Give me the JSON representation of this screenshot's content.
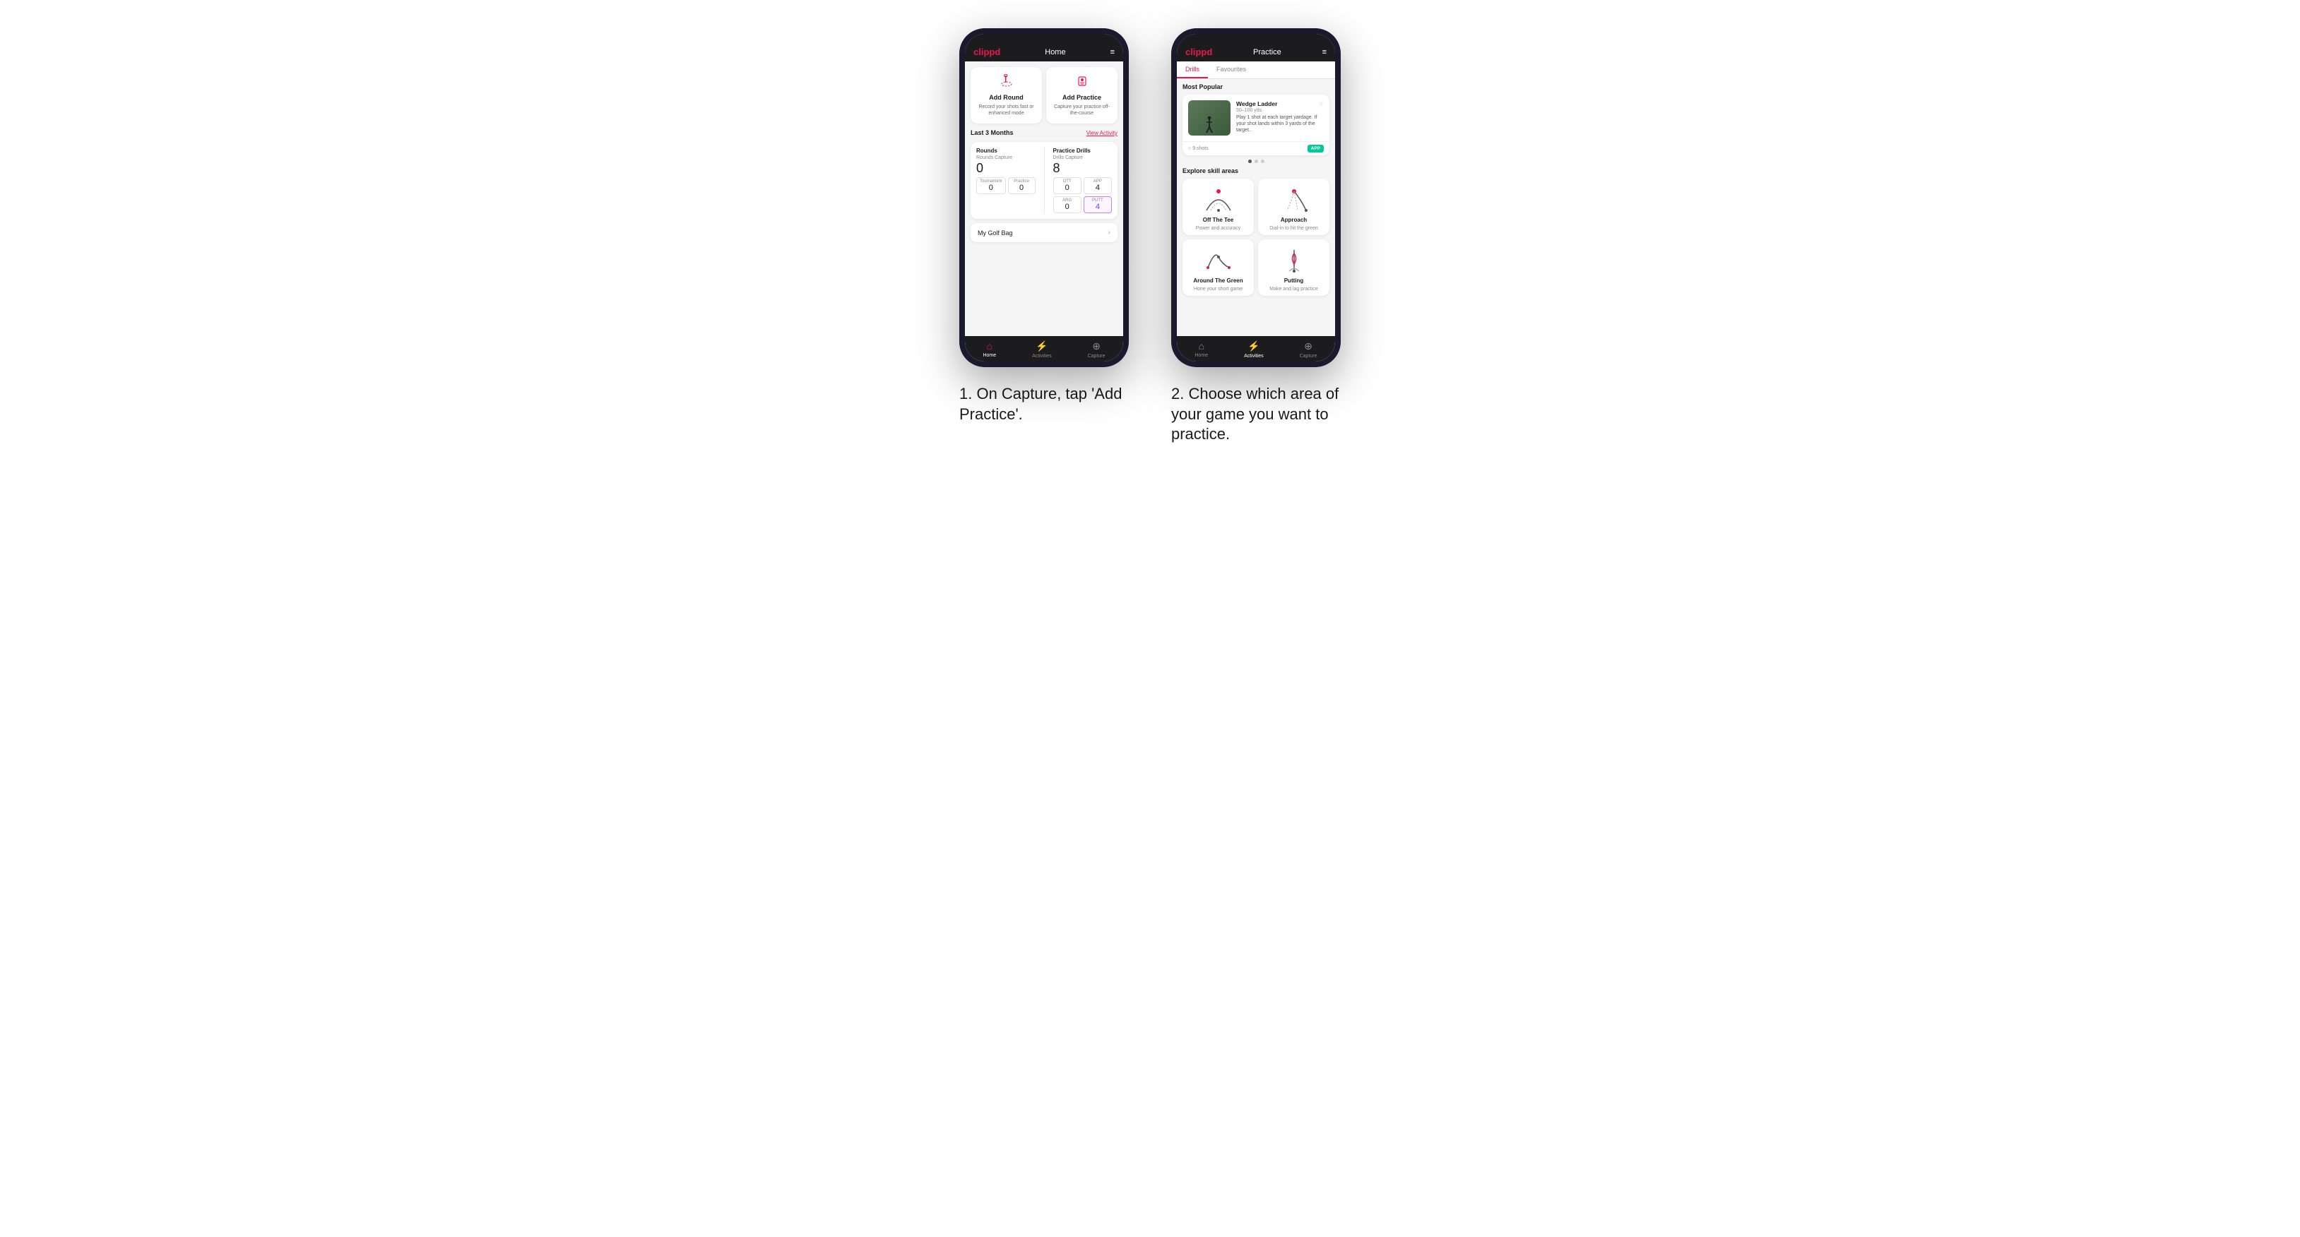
{
  "page": {
    "background": "#ffffff"
  },
  "phone1": {
    "header": {
      "logo": "clippd",
      "title": "Home",
      "menu_icon": "≡"
    },
    "action_cards": [
      {
        "id": "add-round",
        "icon": "⛳",
        "title": "Add Round",
        "subtitle": "Record your shots fast or enhanced mode"
      },
      {
        "id": "add-practice",
        "icon": "🏌",
        "title": "Add Practice",
        "subtitle": "Capture your practice off-the-course"
      }
    ],
    "activity_section": {
      "title": "Last 3 Months",
      "link": "View Activity"
    },
    "stats": {
      "rounds": {
        "label": "Rounds",
        "capture_label": "Rounds Capture",
        "total": "0",
        "sub_items": [
          {
            "label": "Tournament",
            "value": "0"
          },
          {
            "label": "Practice",
            "value": "0"
          }
        ]
      },
      "practice_drills": {
        "label": "Practice Drills",
        "capture_label": "Drills Capture",
        "total": "8",
        "sub_items": [
          {
            "label": "OTT",
            "value": "0"
          },
          {
            "label": "APP",
            "value": "4",
            "highlighted": false
          },
          {
            "label": "ARG",
            "value": "0"
          },
          {
            "label": "PUTT",
            "value": "4",
            "highlighted": true
          }
        ]
      }
    },
    "golf_bag": {
      "label": "My Golf Bag"
    },
    "bottom_nav": [
      {
        "label": "Home",
        "icon": "⌂",
        "active": true
      },
      {
        "label": "Activities",
        "icon": "⚡",
        "active": false
      },
      {
        "label": "Capture",
        "icon": "⊕",
        "active": false
      }
    ]
  },
  "phone2": {
    "header": {
      "logo": "clippd",
      "title": "Practice",
      "menu_icon": "≡"
    },
    "tabs": [
      {
        "label": "Drills",
        "active": true
      },
      {
        "label": "Favourites",
        "active": false
      }
    ],
    "featured": {
      "section_title": "Most Popular",
      "card": {
        "title": "Wedge Ladder",
        "yards": "50–100 yds",
        "description": "Play 1 shot at each target yardage. If your shot lands within 3 yards of the target..",
        "shots": "9 shots",
        "badge": "APP"
      },
      "dots": [
        {
          "active": true
        },
        {
          "active": false
        },
        {
          "active": false
        }
      ]
    },
    "explore": {
      "section_title": "Explore skill areas",
      "skills": [
        {
          "id": "off-the-tee",
          "title": "Off The Tee",
          "subtitle": "Power and accuracy",
          "icon_type": "arc"
        },
        {
          "id": "approach",
          "title": "Approach",
          "subtitle": "Dial-in to hit the green",
          "icon_type": "approach"
        },
        {
          "id": "around-the-green",
          "title": "Around The Green",
          "subtitle": "Hone your short game",
          "icon_type": "arc2"
        },
        {
          "id": "putting",
          "title": "Putting",
          "subtitle": "Make and lag practice",
          "icon_type": "putt"
        }
      ]
    },
    "bottom_nav": [
      {
        "label": "Home",
        "icon": "⌂",
        "active": false
      },
      {
        "label": "Activities",
        "icon": "⚡",
        "active": true
      },
      {
        "label": "Capture",
        "icon": "⊕",
        "active": false
      }
    ]
  },
  "captions": {
    "phone1": "1. On Capture, tap 'Add Practice'.",
    "phone2": "2. Choose which area of your game you want to practice."
  }
}
